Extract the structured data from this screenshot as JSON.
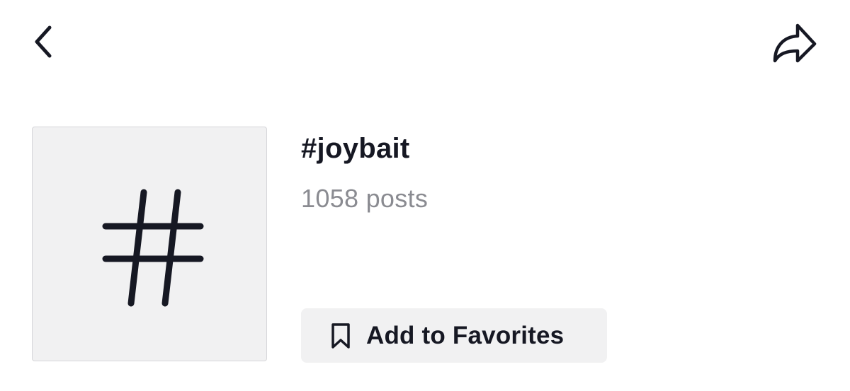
{
  "header": {
    "back_icon": "chevron-left-icon",
    "share_icon": "share-arrow-icon"
  },
  "hashtag": {
    "thumbnail_icon": "hashtag-icon",
    "name": "#joybait",
    "post_count": "1058 posts"
  },
  "actions": {
    "favorite_label": "Add to Favorites",
    "favorite_icon": "bookmark-icon"
  },
  "colors": {
    "text_primary": "#161823",
    "text_secondary": "#8a8b91",
    "surface": "#f1f1f2"
  }
}
